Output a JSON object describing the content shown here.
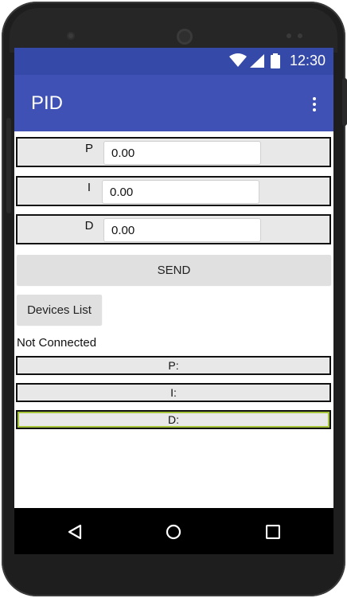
{
  "status_bar": {
    "time": "12:30",
    "icons": [
      "wifi-icon",
      "signal-icon",
      "battery-icon"
    ]
  },
  "app_bar": {
    "title": "PID",
    "menu_icon": "overflow-menu-icon"
  },
  "params": [
    {
      "label": "P",
      "value": "0.00"
    },
    {
      "label": "I",
      "value": "0.00"
    },
    {
      "label": "D",
      "value": "0.00"
    }
  ],
  "buttons": {
    "send": "SEND",
    "devices": "Devices List"
  },
  "connection_status": "Not Connected",
  "outputs": [
    {
      "label": "P:"
    },
    {
      "label": "I:"
    },
    {
      "label": "D:"
    }
  ],
  "nav_bar": {
    "icons": [
      "back-icon",
      "home-icon",
      "recent-apps-icon"
    ]
  },
  "colors": {
    "status_bar": "#3549a8",
    "app_bar": "#3f51b5",
    "accent_outline": "#a6c53a"
  }
}
